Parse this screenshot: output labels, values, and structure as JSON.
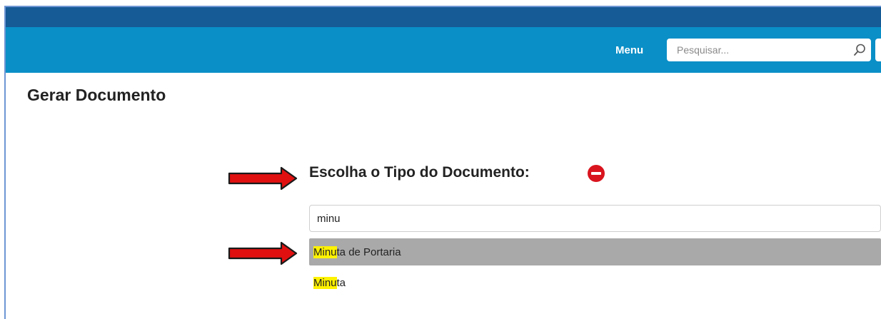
{
  "header": {
    "menu_label": "Menu",
    "search_placeholder": "Pesquisar..."
  },
  "page": {
    "title": "Gerar Documento"
  },
  "doc_type": {
    "label": "Escolha o Tipo do Documento:",
    "input_value": "minu",
    "options": [
      {
        "match": "Minu",
        "rest": "ta de Portaria",
        "selected": true
      },
      {
        "match": "Minu",
        "rest": "ta",
        "selected": false
      }
    ]
  },
  "colors": {
    "topbar_dark": "#165a96",
    "topbar": "#0a8fc7",
    "highlight": "#fff200",
    "selected_option": "#a9a9a9",
    "remove_icon": "#d9141e",
    "arrow": "#e01010"
  }
}
